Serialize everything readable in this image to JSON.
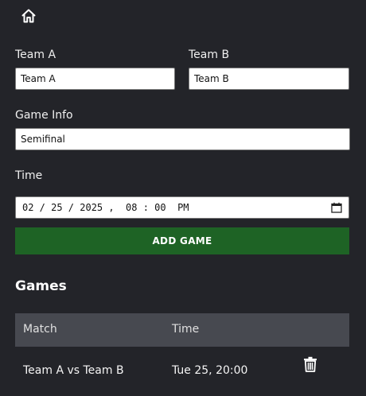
{
  "nav": {
    "home_icon": "home-icon"
  },
  "form": {
    "team_a": {
      "label": "Team A",
      "value": "Team A"
    },
    "team_b": {
      "label": "Team B",
      "value": "Team B"
    },
    "game_info": {
      "label": "Game Info",
      "value": "Semifinal"
    },
    "time": {
      "label": "Time",
      "value": "02 / 25 / 2025 ,  08 : 00  PM",
      "picker_icon": "calendar-icon"
    },
    "add_button": "ADD GAME"
  },
  "games": {
    "title": "Games",
    "columns": {
      "match": "Match",
      "time": "Time"
    },
    "rows": [
      {
        "match": "Team A vs Team B",
        "time": "Tue 25, 20:00",
        "action_icon": "trash-icon"
      }
    ]
  },
  "colors": {
    "background": "#232429",
    "add_button": "#1e6325",
    "table_header": "#474950"
  }
}
